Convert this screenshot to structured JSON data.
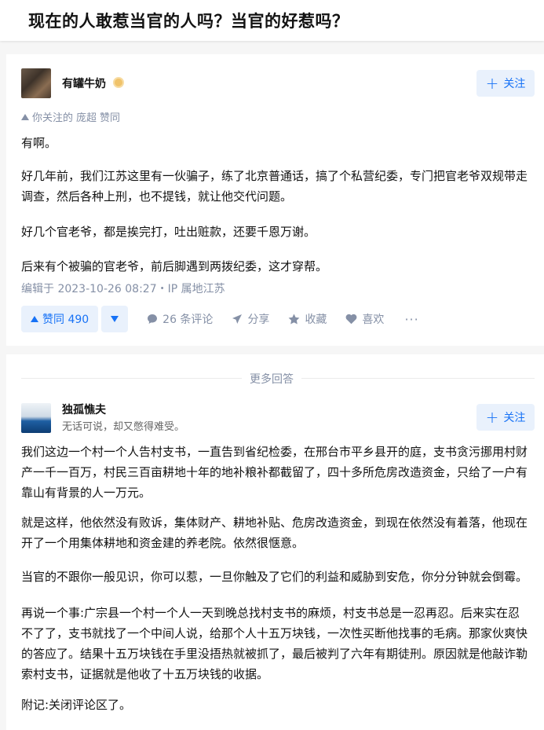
{
  "question": {
    "title": "现在的人敢惹当官的人吗？当官的好惹吗？"
  },
  "answer1": {
    "author": {
      "name": "有罐牛奶"
    },
    "follow_label": "关注",
    "upvote_note": {
      "prefix": "你关注的",
      "user": "庞超",
      "action": "赞同"
    },
    "paragraphs": [
      "有啊。",
      "好几年前，我们江苏这里有一伙骗子，练了北京普通话，搞了个私营纪委，专门把官老爷双规带走调查，然后各种上刑，也不提钱，就让他交代问题。",
      "好几个官老爷，都是挨完打，吐出赃款，还要千恩万谢。",
      "后来有个被骗的官老爷，前后脚遇到两拨纪委，这才穿帮。"
    ],
    "edit_meta": "编辑于 2023-10-26 08:27・IP 属地江苏",
    "actions": {
      "vote_label": "赞同 490",
      "comment_label": "26 条评论",
      "share_label": "分享",
      "collect_label": "收藏",
      "like_label": "喜欢",
      "more_label": "···"
    }
  },
  "more_answers_label": "更多回答",
  "answer2": {
    "author": {
      "name": "独孤憔夫",
      "bio": "无话可说，却又憋得难受。"
    },
    "follow_label": "关注",
    "paragraphs": [
      "我们这边一个村一个人告村支书，一直告到省纪检委，在邢台市平乡县开的庭，支书贪污挪用村财产一千一百万，村民三百亩耕地十年的地补粮补都截留了，四十多所危房改造资金，只给了一户有靠山有背景的人一万元。",
      "就是这样，他依然没有败诉，集体财产、耕地补贴、危房改造资金，到现在依然没有着落，他现在开了一个用集体耕地和资金建的养老院。依然很惬意。",
      "当官的不跟你一般见识，你可以惹，一旦你触及了它们的利益和威胁到安危，你分分钟就会倒霉。",
      "再说一个事:广宗县一个村一个人一天到晚总找村支书的麻烦，村支书总是一忍再忍。后来实在忍不了了，支书就找了一个中间人说，给那个人十五万块钱，一次性买断他找事的毛病。那家伙爽快的答应了。结果十五万块钱在手里没捂热就被抓了，最后被判了六年有期徒刑。原因就是他敲诈勒索村支书，证据就是他收了十五万块钱的收据。",
      "附记:关闭评论区了。"
    ]
  }
}
